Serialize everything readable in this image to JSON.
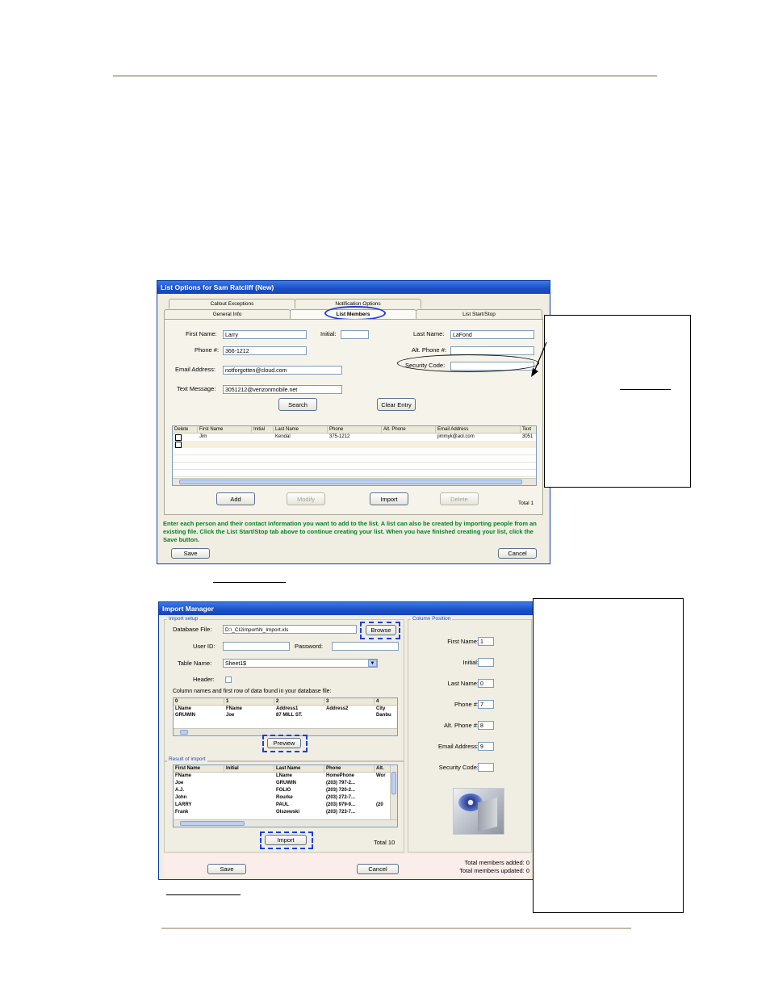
{
  "list_options": {
    "title": "List Options for Sam Ratcliff (New)",
    "tabs_back": [
      "Callout Exceptions",
      "Notification Options"
    ],
    "tabs_front": [
      "General Info",
      "List Members",
      "List Start/Stop"
    ],
    "active_tab": "List Members",
    "fields": {
      "first_name_label": "First Name:",
      "first_name_value": "Larry",
      "initial_label": "Initial:",
      "initial_value": "",
      "last_name_label": "Last Name:",
      "last_name_value": "LaFond",
      "phone_label": "Phone #:",
      "phone_value": "366-1212",
      "alt_phone_label": "Alt. Phone #:",
      "alt_phone_value": "",
      "email_label": "Email Address:",
      "email_value": "notforgotten@cloud.com",
      "security_label": "Security Code:",
      "security_value": "",
      "text_label": "Text Message:",
      "text_value": "3051212@verizonmobile.net"
    },
    "search_label": "Search",
    "clear_label": "Clear Entry",
    "table": {
      "columns": [
        "Delete",
        "First Name",
        "Initial",
        "Last Name",
        "Phone",
        "Alt. Phone",
        "Email Address",
        "Text"
      ],
      "rows": [
        [
          "",
          "Jim",
          "",
          "Kendal",
          "375-1212",
          "",
          "jimmyk@aol.com",
          "3051"
        ]
      ]
    },
    "buttons": {
      "add": "Add",
      "modify": "Modify",
      "import": "Import",
      "delete": "Delete"
    },
    "total": "Total 1",
    "instructions": "Enter each person and their contact information you want to add to the list. A list can also be created by importing people from an existing file. Click the List Start/Stop tab above to continue creating your list. When you have finished creating your list, click the Save button.",
    "save": "Save",
    "cancel": "Cancel"
  },
  "import_manager": {
    "title": "Import Manager",
    "import_setup_label": "Import setup",
    "database_file_label": "Database File:",
    "database_file_value": "D:\\_CI2import\\N_Import.xls",
    "browse": "Browse",
    "user_id_label": "User ID:",
    "user_id_value": "",
    "password_label": "Password:",
    "password_value": "",
    "table_name_label": "Table Name:",
    "table_name_value": "Sheet1$",
    "header_label": "Header:",
    "columns_note": "Column names and first row of data found in your database file:",
    "preview_table": {
      "columns": [
        "0",
        "1",
        "2",
        "3",
        "4"
      ],
      "rows": [
        [
          "LName",
          "FName",
          "Address1",
          "Address2",
          "City"
        ],
        [
          "GRUWIN",
          "Joe",
          "87 MILL ST.",
          "",
          "Danbu"
        ]
      ]
    },
    "preview": "Preview",
    "result_label": "Result of import",
    "result_table": {
      "columns": [
        "First Name",
        "Initial",
        "Last Name",
        "Phone",
        "Alt."
      ],
      "rows": [
        [
          "FName",
          "",
          "LName",
          "HomePhone",
          "Wor"
        ],
        [
          "Joe",
          "",
          "GRUWIN",
          "(203) 797-2...",
          ""
        ],
        [
          "A.J.",
          "",
          "FOLIO",
          "(203) 720-2...",
          ""
        ],
        [
          "John",
          "",
          "Rourke",
          "(203) 272-7...",
          ""
        ],
        [
          "LARRY",
          "",
          "PAUL",
          "(203) 979-9...",
          "(20"
        ],
        [
          "Frank",
          "",
          "Olszewski",
          "(203) 723-7...",
          ""
        ]
      ]
    },
    "import": "Import",
    "total": "Total 10",
    "column_position_label": "Column Position",
    "positions": [
      {
        "label": "First Name:",
        "value": "1"
      },
      {
        "label": "Initial:",
        "value": ""
      },
      {
        "label": "Last Name:",
        "value": "0"
      },
      {
        "label": "Phone #:",
        "value": "7"
      },
      {
        "label": "Alt. Phone #:",
        "value": "8"
      },
      {
        "label": "Email Address:",
        "value": "9"
      },
      {
        "label": "Security Code:",
        "value": ""
      }
    ],
    "save": "Save",
    "cancel": "Cancel",
    "members_added": "Total members added: 0",
    "members_updated": "Total members updated: 0"
  }
}
